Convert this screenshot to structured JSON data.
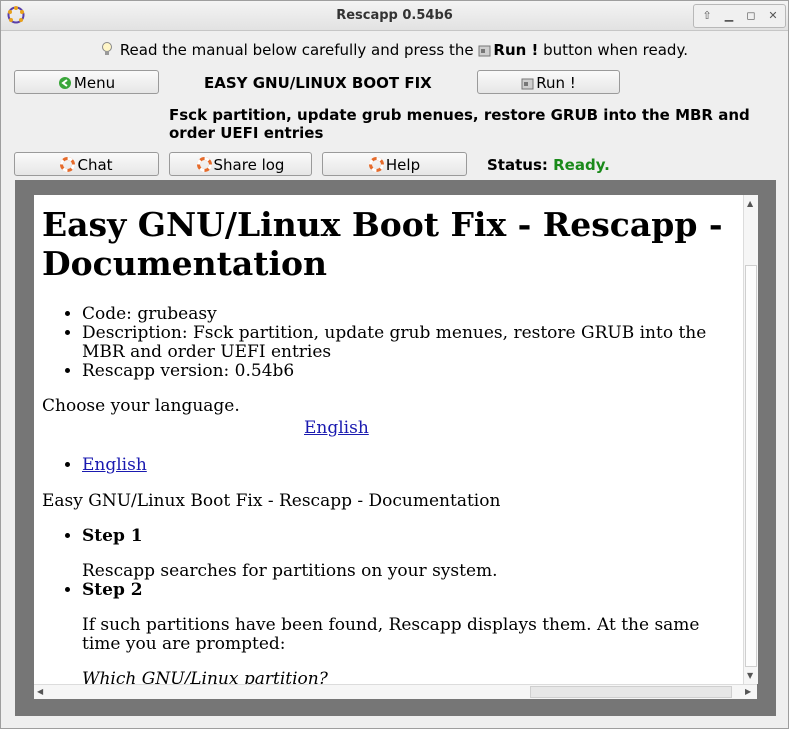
{
  "window": {
    "title": "Rescapp 0.54b6",
    "app_icon": "rescapp-logo-icon"
  },
  "title_buttons": [
    {
      "name": "keep-above-icon",
      "glyph": "⇧"
    },
    {
      "name": "minimize-icon",
      "glyph": "▁"
    },
    {
      "name": "maximize-icon",
      "glyph": "◻"
    },
    {
      "name": "close-icon",
      "glyph": "✕"
    }
  ],
  "hint": {
    "icon": "lightbulb-icon",
    "before": "Read the manual below carefully and press the",
    "run": "Run !",
    "after": "button when ready."
  },
  "toolbar": {
    "menu_label": "Menu",
    "heading": "EASY GNU/LINUX BOOT FIX",
    "run_label": "Run !",
    "description": "Fsck partition, update grub menues, restore GRUB into the MBR and order UEFI entries",
    "chat_label": "Chat",
    "share_log_label": "Share log",
    "help_label": "Help",
    "status_label": "Status:",
    "status_value": "Ready.",
    "status_color": "#1a8a1a"
  },
  "doc": {
    "title": "Easy GNU/Linux Boot Fix - Rescapp - Documentation",
    "info_items": [
      "Code: grubeasy",
      "Description: Fsck partition, update grub menues, restore GRUB into the MBR and order UEFI entries",
      "Rescapp version: 0.54b6"
    ],
    "choose_language": "Choose your language.",
    "language_link_center": "English",
    "language_link_list": "English",
    "doc_subtitle": "Easy GNU/Linux Boot Fix - Rescapp - Documentation",
    "steps": [
      {
        "title": "Step 1",
        "text": "Rescapp searches for partitions on your system."
      },
      {
        "title": "Step 2",
        "text": "If such partitions have been found, Rescapp displays them. At the same time you are prompted:"
      }
    ],
    "prompt": "Which GNU/Linux partition?"
  }
}
